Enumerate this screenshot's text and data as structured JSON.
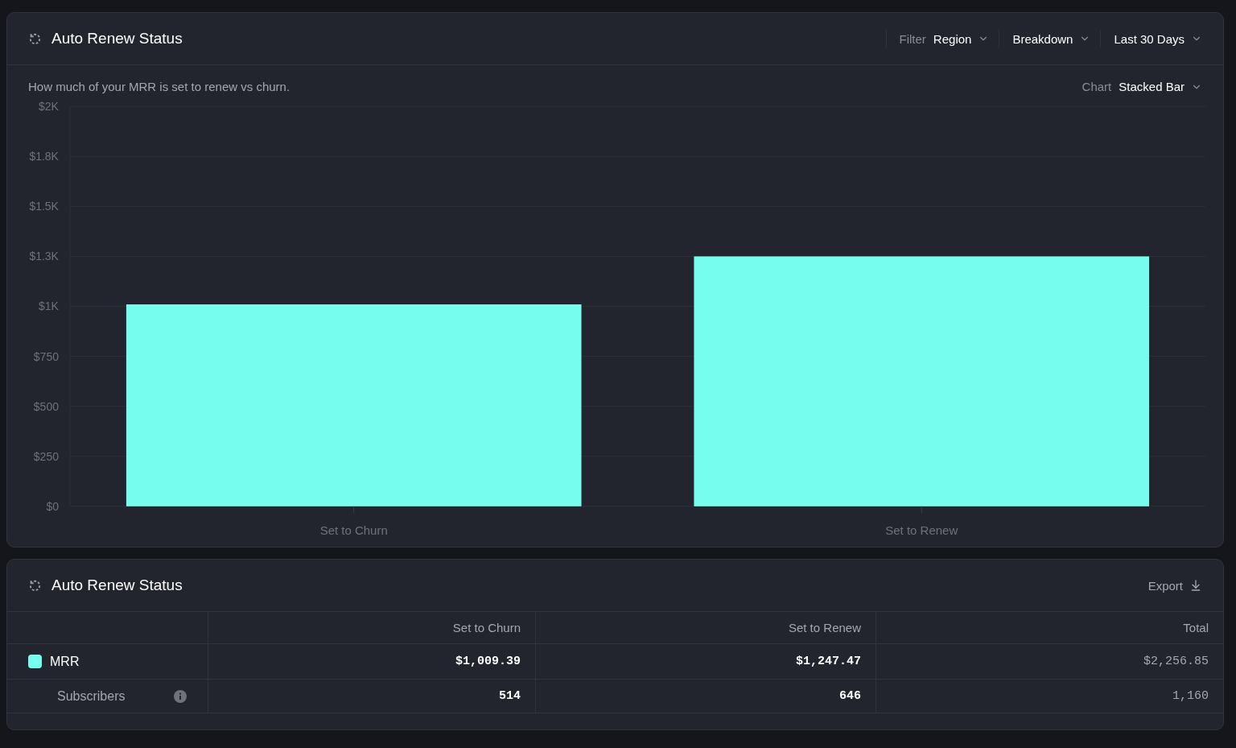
{
  "chart_panel": {
    "title": "Auto Renew Status",
    "controls": [
      {
        "label": "Filter",
        "value": "Region"
      },
      {
        "value": "Breakdown"
      },
      {
        "value": "Last 30 Days"
      }
    ],
    "description": "How much of your MRR is set to renew vs churn.",
    "chart_selector": {
      "label": "Chart",
      "value": "Stacked Bar"
    },
    "chart_data": {
      "type": "bar",
      "grid": true,
      "categories": [
        "Set to Churn",
        "Set to Renew"
      ],
      "series": [
        {
          "color": "#77fdee",
          "values": [
            1010,
            1250
          ]
        }
      ],
      "ylim": [
        0,
        2000
      ],
      "yticks": [
        {
          "value": 0,
          "label": "$0"
        },
        {
          "value": 250,
          "label": "$250"
        },
        {
          "value": 500,
          "label": "$500"
        },
        {
          "value": 750,
          "label": "$750"
        },
        {
          "value": 1000,
          "label": "$1K"
        },
        {
          "value": 1250,
          "label": "$1.3K"
        },
        {
          "value": 1500,
          "label": "$1.5K"
        },
        {
          "value": 1750,
          "label": "$1.8K"
        },
        {
          "value": 2000,
          "label": "$2K"
        }
      ]
    }
  },
  "table_panel": {
    "title": "Auto Renew Status",
    "export_label": "Export",
    "columns": [
      "Set to Churn",
      "Set to Renew",
      "Total"
    ],
    "rows": [
      {
        "kind": "series",
        "label": "MRR",
        "color": "#77fdee",
        "values": [
          "$1,009.39",
          "$1,247.47"
        ],
        "total": "$2,256.85"
      },
      {
        "kind": "metric",
        "label": "Subscribers",
        "values": [
          "514",
          "646"
        ],
        "total": "1,160"
      }
    ]
  }
}
